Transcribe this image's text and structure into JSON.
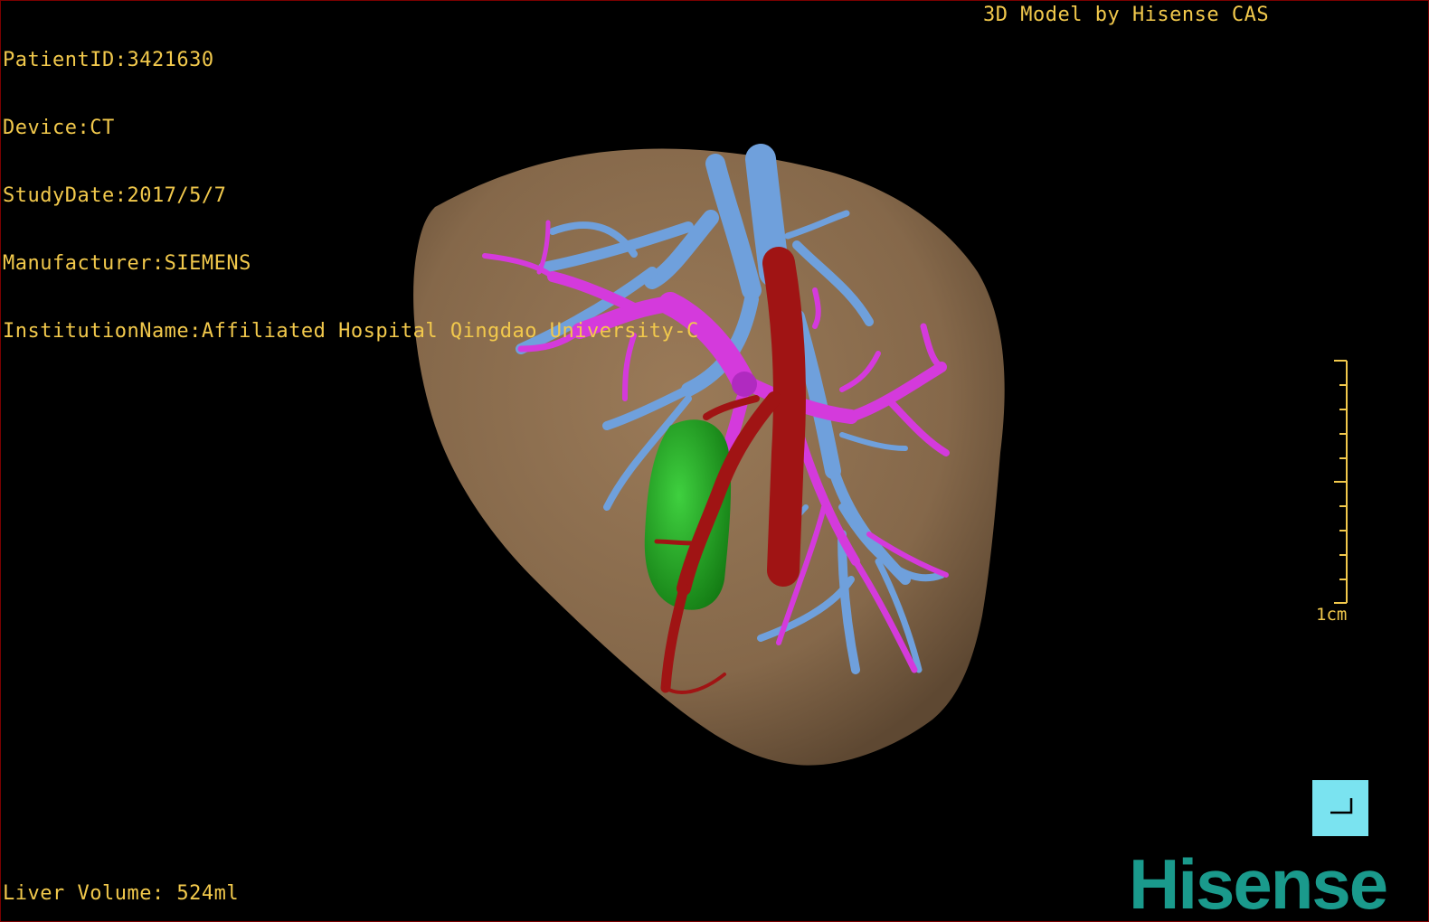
{
  "patient_info": {
    "patient_id": "PatientID:3421630",
    "device": "Device:CT",
    "study_date": "StudyDate:2017/5/7",
    "manufacturer": "Manufacturer:SIEMENS",
    "institution": "InstitutionName:Affiliated Hospital Qingdao University-C"
  },
  "model_credit": "3D Model by Hisense CAS",
  "liver_volume": "Liver Volume: 524ml",
  "scale": {
    "label": "1cm"
  },
  "corner_button": {
    "icon": "corner-bracket-icon"
  },
  "brand": "Hisense",
  "colors": {
    "overlay_text": "#f2c94c",
    "liver": "#8c6e4f",
    "hepatic_vein": "#6fa0dc",
    "portal_vein": "#d43adc",
    "artery": "#a01414",
    "tumor": "#1ea31e",
    "brand": "#1a9a8c",
    "button": "#7ae3f0"
  }
}
